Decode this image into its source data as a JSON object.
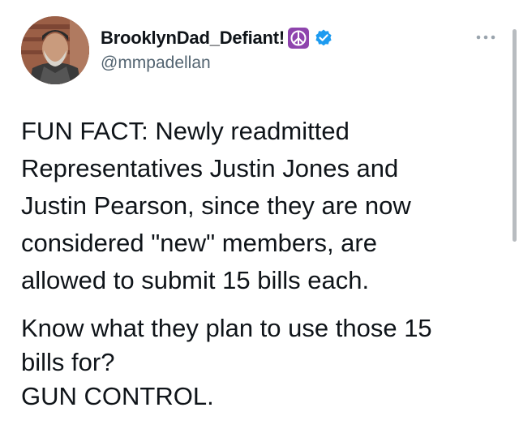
{
  "tweet": {
    "author": {
      "display_name": "BrooklynDad_Defiant!",
      "handle": "@mmpadellan",
      "avatar_icon": "profile-photo",
      "badge_icons": [
        "peace-sign-icon",
        "verified-badge-icon"
      ]
    },
    "more_icon": "more-horizontal-icon",
    "paragraph1_lines": [
      "FUN FACT: Newly readmitted",
      "Representatives Justin Jones and",
      "Justin Pearson, since they are now",
      "considered \"new\" members, are",
      "allowed to submit 15 bills each."
    ],
    "paragraph2_lines": [
      "Know what they plan to use those 15",
      "bills for?",
      "GUN CONTROL."
    ]
  },
  "colors": {
    "text": "#0f1419",
    "secondary_text": "#536471",
    "verified_blue": "#1d9bf0",
    "peace_purple": "#8e44ad"
  }
}
